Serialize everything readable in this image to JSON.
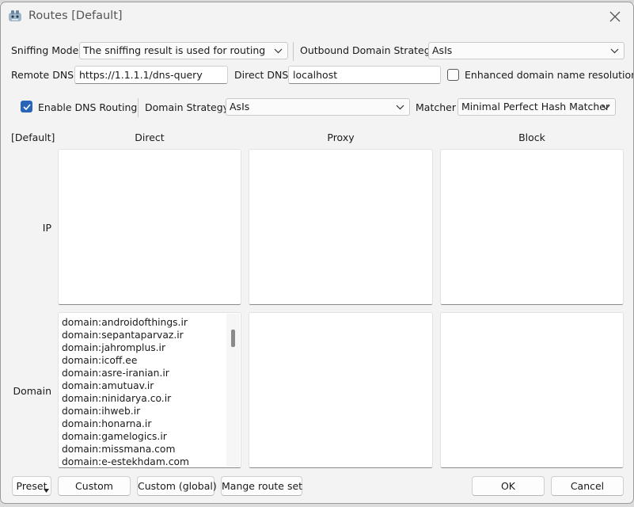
{
  "window": {
    "title": "Routes [Default]"
  },
  "top_row": {
    "sniffing_mode_label": "Sniffing Mode",
    "sniffing_mode_value": "The sniffing result is used for routing",
    "outbound_strategy_label": "Outbound Domain Strategy",
    "outbound_strategy_value": "AsIs"
  },
  "dns_row": {
    "remote_dns_label": "Remote DNS",
    "remote_dns_value": "https://1.1.1.1/dns-query",
    "direct_dns_label": "Direct DNS",
    "direct_dns_value": "localhost",
    "enhanced_label": "Enhanced domain name resolution",
    "enhanced_checked": false
  },
  "routing_row": {
    "enable_dns_label": "Enable DNS Routing",
    "enable_dns_checked": true,
    "domain_strategy_label": "Domain Strategy",
    "domain_strategy_value": "AsIs",
    "matcher_label": "Matcher",
    "matcher_value": "Minimal Perfect Hash Matcher"
  },
  "grid": {
    "corner_label": "[Default]",
    "columns": [
      "Direct",
      "Proxy",
      "Block"
    ],
    "rows": [
      "IP",
      "Domain"
    ],
    "direct_domain_list": [
      "domain:androidofthings.ir",
      "domain:sepantaparvaz.ir",
      "domain:jahromplus.ir",
      "domain:icoff.ee",
      "domain:asre-iranian.ir",
      "domain:amutuav.ir",
      "domain:ninidarya.co.ir",
      "domain:ihweb.ir",
      "domain:honarna.ir",
      "domain:gamelogics.ir",
      "domain:missmana.com",
      "domain:e-estekhdam.com"
    ]
  },
  "buttons": {
    "preset": "Preset",
    "custom": "Custom",
    "custom_global": "Custom (global)",
    "manage_route_set": "Mange route set",
    "ok": "OK",
    "cancel": "Cancel"
  },
  "colors": {
    "accent": "#2a64b8"
  }
}
